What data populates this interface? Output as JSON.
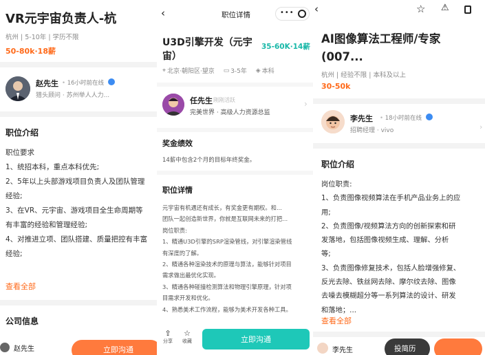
{
  "panel1": {
    "job_title": "VR元宇宙负责人-杭",
    "meta": "杭州 | 5-10年 | 学历不限",
    "salary": "50-80k·18薪",
    "recruiter_name": "赵先生",
    "recruiter_online": "16小时前在线",
    "recruiter_role": "猎头顾问 · 苏州举人人力...",
    "section_intro": "职位介绍",
    "requirements": [
      "职位要求",
      "1、统招本科，重点本科优先;",
      "2、5年以上头部游戏项目负责人及团队管理",
      "经验;",
      "3、在VR、元宇宙、游戏项目全生命周期等",
      "有丰富的经验和管理经验;",
      "4、对推进立项、团队搭建、质量把控有丰富",
      "经验;"
    ],
    "view_all": "查看全部",
    "section_company": "公司信息",
    "footer_name": "赵先生",
    "footer_button": "立即沟通"
  },
  "panel2": {
    "nav_title": "职位详情",
    "job_title_line1": "U3D引擎开发（元宇",
    "job_title_line2": "宙）",
    "salary": "35-60K·14薪",
    "location": "北京·朝阳区·望京",
    "experience": "3-5年",
    "education": "本科",
    "recruiter_name": "任先生",
    "recruiter_status": "刚刚活跃",
    "recruiter_role": "完美世界 · 高级人力资源总监",
    "section_bonus": "奖金绩效",
    "bonus_text": "14薪中包含2个月的目标年终奖金。",
    "section_detail": "职位详情",
    "detail_lines": [
      "元宇宙有机遇还有成长，有奖金更有期权。和...",
      "团队一起创造新世界，你就是互联网未来的打把...",
      "岗位职责:",
      "1、精通U3D引擎的SRP渲染管线，对引擎渲染管线",
      "有深度的了解。",
      "2、精通各种渲染技术的原理与算法，能够针对项目",
      "需求做出最优化实现。",
      "3、精通各种碰撞检测算法和物理引擎原理，针对项",
      "目需求开发和优化。",
      "4、熟悉美术工作流程，能够为美术开发各种工具。"
    ],
    "share_label": "分享",
    "fav_label": "收藏",
    "chat_button": "立即沟通"
  },
  "panel3": {
    "job_title_line1": "AI图像算法工程师/专家",
    "job_title_line2": "(007...",
    "meta": "杭州 | 经验不限 | 本科及以上",
    "salary": "30-50k",
    "recruiter_name": "李先生",
    "recruiter_online": "18小时前在线",
    "recruiter_role": "招聘经理 · vivo",
    "section_intro": "职位介绍",
    "duties": [
      "岗位职责:",
      "1、负责图像视频算法在手机产品业务上的应",
      "用;",
      "2、负责图像/视频算法方向的创新探索和研",
      "发落地，包括图像视频生成、理解、分析",
      "等;",
      "3、负责图像修复技术，包括人脸增强修复、",
      "反光去除、铁丝网去除、摩尔纹去除、图像",
      "去噪去模糊超分等一系列算法的设计、研发",
      "和落地；..."
    ],
    "view_all": "查看全部",
    "footer_name": "李先生",
    "footer_button": "投简历"
  },
  "colors": {
    "accent_orange": "#ff6a1a",
    "teal_button": "#1ec8b8",
    "salary_teal": "#19b8a8",
    "verified_blue": "#3c8cf2"
  }
}
